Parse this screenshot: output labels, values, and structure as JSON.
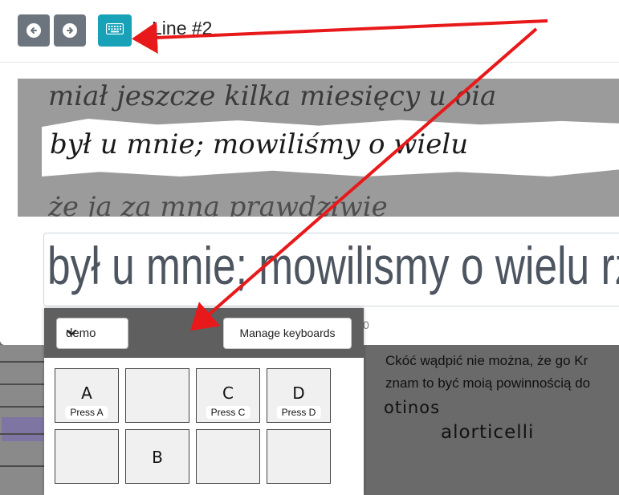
{
  "header": {
    "title": "Line #2"
  },
  "colors": {
    "nav_button": "#6c757d",
    "keyboard_button": "#17a2b8",
    "annotation_arrow": "#e8191a"
  },
  "icons": {
    "prev": "arrow-left-circle-icon",
    "next": "arrow-right-circle-icon",
    "keyboard": "keyboard-icon"
  },
  "scan_lines": {
    "line1": "miał jeszcze kilka miesięcy u oia",
    "line2": "był u mnie; mowiliśmy o wielu",
    "line3": "że ja za mną prawdziwie"
  },
  "transcription": {
    "value": "był u mnie; mowilismy o wielu rz"
  },
  "stray_text": "0",
  "keyboard_panel": {
    "selected_keyboard": "demo",
    "manage_label": "Manage keyboards",
    "keys": [
      {
        "char": "A",
        "label": "Press A"
      },
      {
        "char": "",
        "label": ""
      },
      {
        "char": "C",
        "label": "Press C"
      },
      {
        "char": "D",
        "label": "Press D"
      },
      {
        "char": "",
        "label": ""
      },
      {
        "char": "B",
        "label": ""
      },
      {
        "char": "",
        "label": ""
      },
      {
        "char": "",
        "label": ""
      }
    ]
  },
  "background_page": {
    "text_lines": [
      "Ckóć wądpić nie można, że go Kr",
      "znam to być moią powinnością do"
    ],
    "word1": "otinos",
    "word2": "alorticelli"
  }
}
